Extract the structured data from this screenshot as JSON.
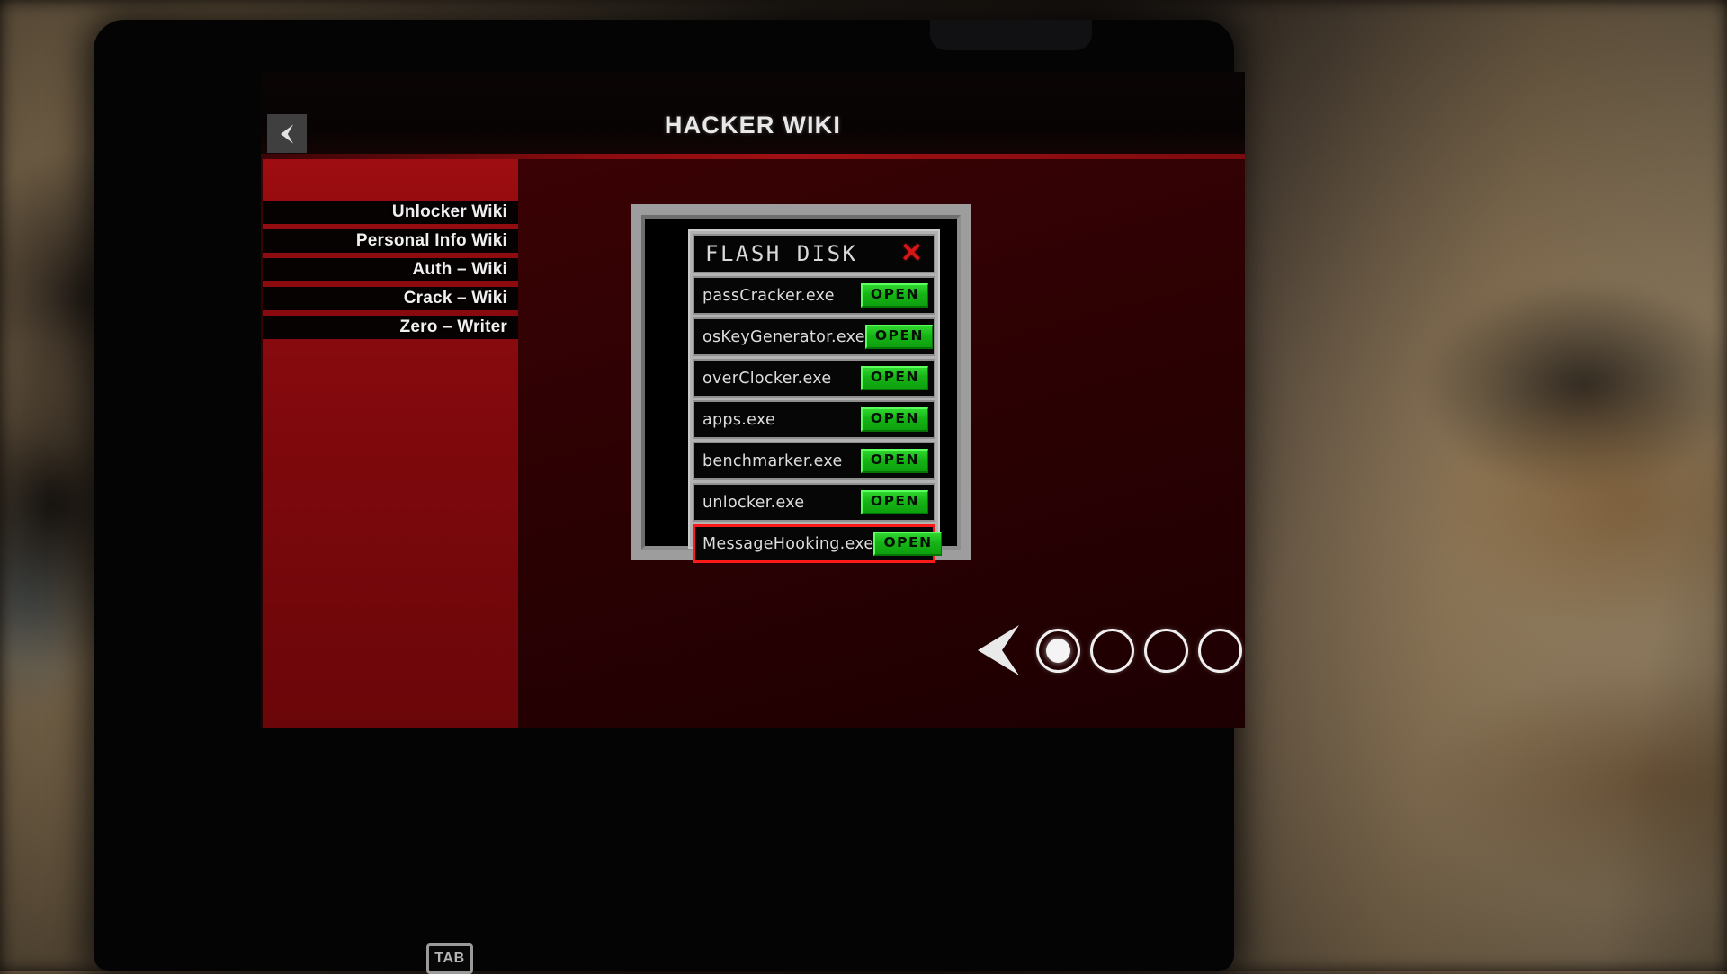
{
  "header": {
    "title": "HACKER WIKI",
    "back_icon": "left-arrow-icon"
  },
  "sidebar": {
    "items": [
      {
        "label": "Unlocker Wiki"
      },
      {
        "label": "Personal Info Wiki"
      },
      {
        "label": "Auth – Wiki"
      },
      {
        "label": "Crack – Wiki"
      },
      {
        "label": "Zero – Writer"
      }
    ]
  },
  "file_window": {
    "title": "FLASH DISK",
    "close_icon": "✕",
    "files": [
      {
        "name": "passCracker.exe",
        "action": "OPEN",
        "selected": false
      },
      {
        "name": "osKeyGenerator.exe",
        "action": "OPEN",
        "selected": false
      },
      {
        "name": "overClocker.exe",
        "action": "OPEN",
        "selected": false
      },
      {
        "name": "apps.exe",
        "action": "OPEN",
        "selected": false
      },
      {
        "name": "benchmarker.exe",
        "action": "OPEN",
        "selected": false
      },
      {
        "name": "unlocker.exe",
        "action": "OPEN",
        "selected": false
      },
      {
        "name": "MessageHooking.exe",
        "action": "OPEN",
        "selected": true
      }
    ]
  },
  "pagination": {
    "prev_icon": "left-arrow-icon",
    "next_icon": "right-arrow-icon",
    "total_pages": 4,
    "current_page": 1
  },
  "key_hint": {
    "label": "TAB"
  },
  "colors": {
    "accent_red": "#8d0c10",
    "selection_red": "#ff1a1a",
    "open_green": "#16b416",
    "close_red": "#d81616",
    "chrome_gray": "#9d9d9d"
  }
}
